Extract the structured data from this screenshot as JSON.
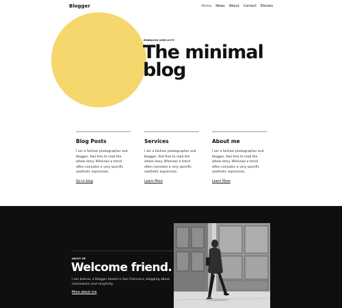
{
  "header": {
    "logo": "Blogger",
    "nav": [
      "Home",
      "News",
      "About",
      "Contact",
      "Ebooks"
    ]
  },
  "hero": {
    "eyebrow": "EMBRACED SIMPLICITY",
    "title_line1": "The minimal",
    "title_line2": "blog"
  },
  "columns": [
    {
      "title": "Blog Posts",
      "text": "I am a fashion photographer and blogger, feel free to read the whole story. Whereas a trend often connotes a very specific aesthetic expression.",
      "link": "Go to blog"
    },
    {
      "title": "Services",
      "text": "I am a fashion photographer and blogger, feel free to read the whole story. Whereas a trend often connotes a very specific aesthetic expression.",
      "link": "Learn More"
    },
    {
      "title": "About me",
      "text": "I am a fashion photographer and blogger, feel free to read the whole story. Whereas a trend often connotes a very specific aesthetic expression.",
      "link": "Learn More"
    }
  ],
  "about": {
    "eyebrow": "ABOUT ME",
    "title": "Welcome friend.",
    "text": "I am Joshua, a blogger based in San Francisco, blogging about minimalism and simplicity.",
    "link": "More about me"
  },
  "colors": {
    "accent": "#f5d76e",
    "dark_bg": "#0f0f0f"
  }
}
